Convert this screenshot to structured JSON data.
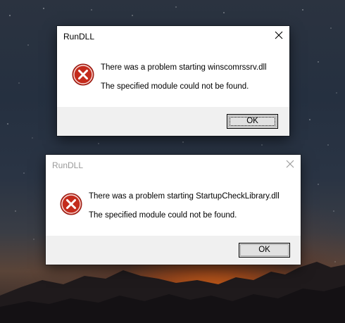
{
  "dialog1": {
    "title": "RunDLL",
    "message": "There was a problem starting winscomrssrv.dll",
    "detail": "The specified module could not be found.",
    "ok_label": "OK"
  },
  "dialog2": {
    "title": "RunDLL",
    "message": "There was a problem starting StartupCheckLibrary.dll",
    "detail": "The specified module could not be found.",
    "ok_label": "OK"
  },
  "icons": {
    "error": "error-icon",
    "close": "close-icon"
  },
  "colors": {
    "error_red": "#c42b1c",
    "button_face": "#e1e1e1",
    "dialog_footer": "#f0f0f0",
    "inactive_title": "#999999"
  }
}
